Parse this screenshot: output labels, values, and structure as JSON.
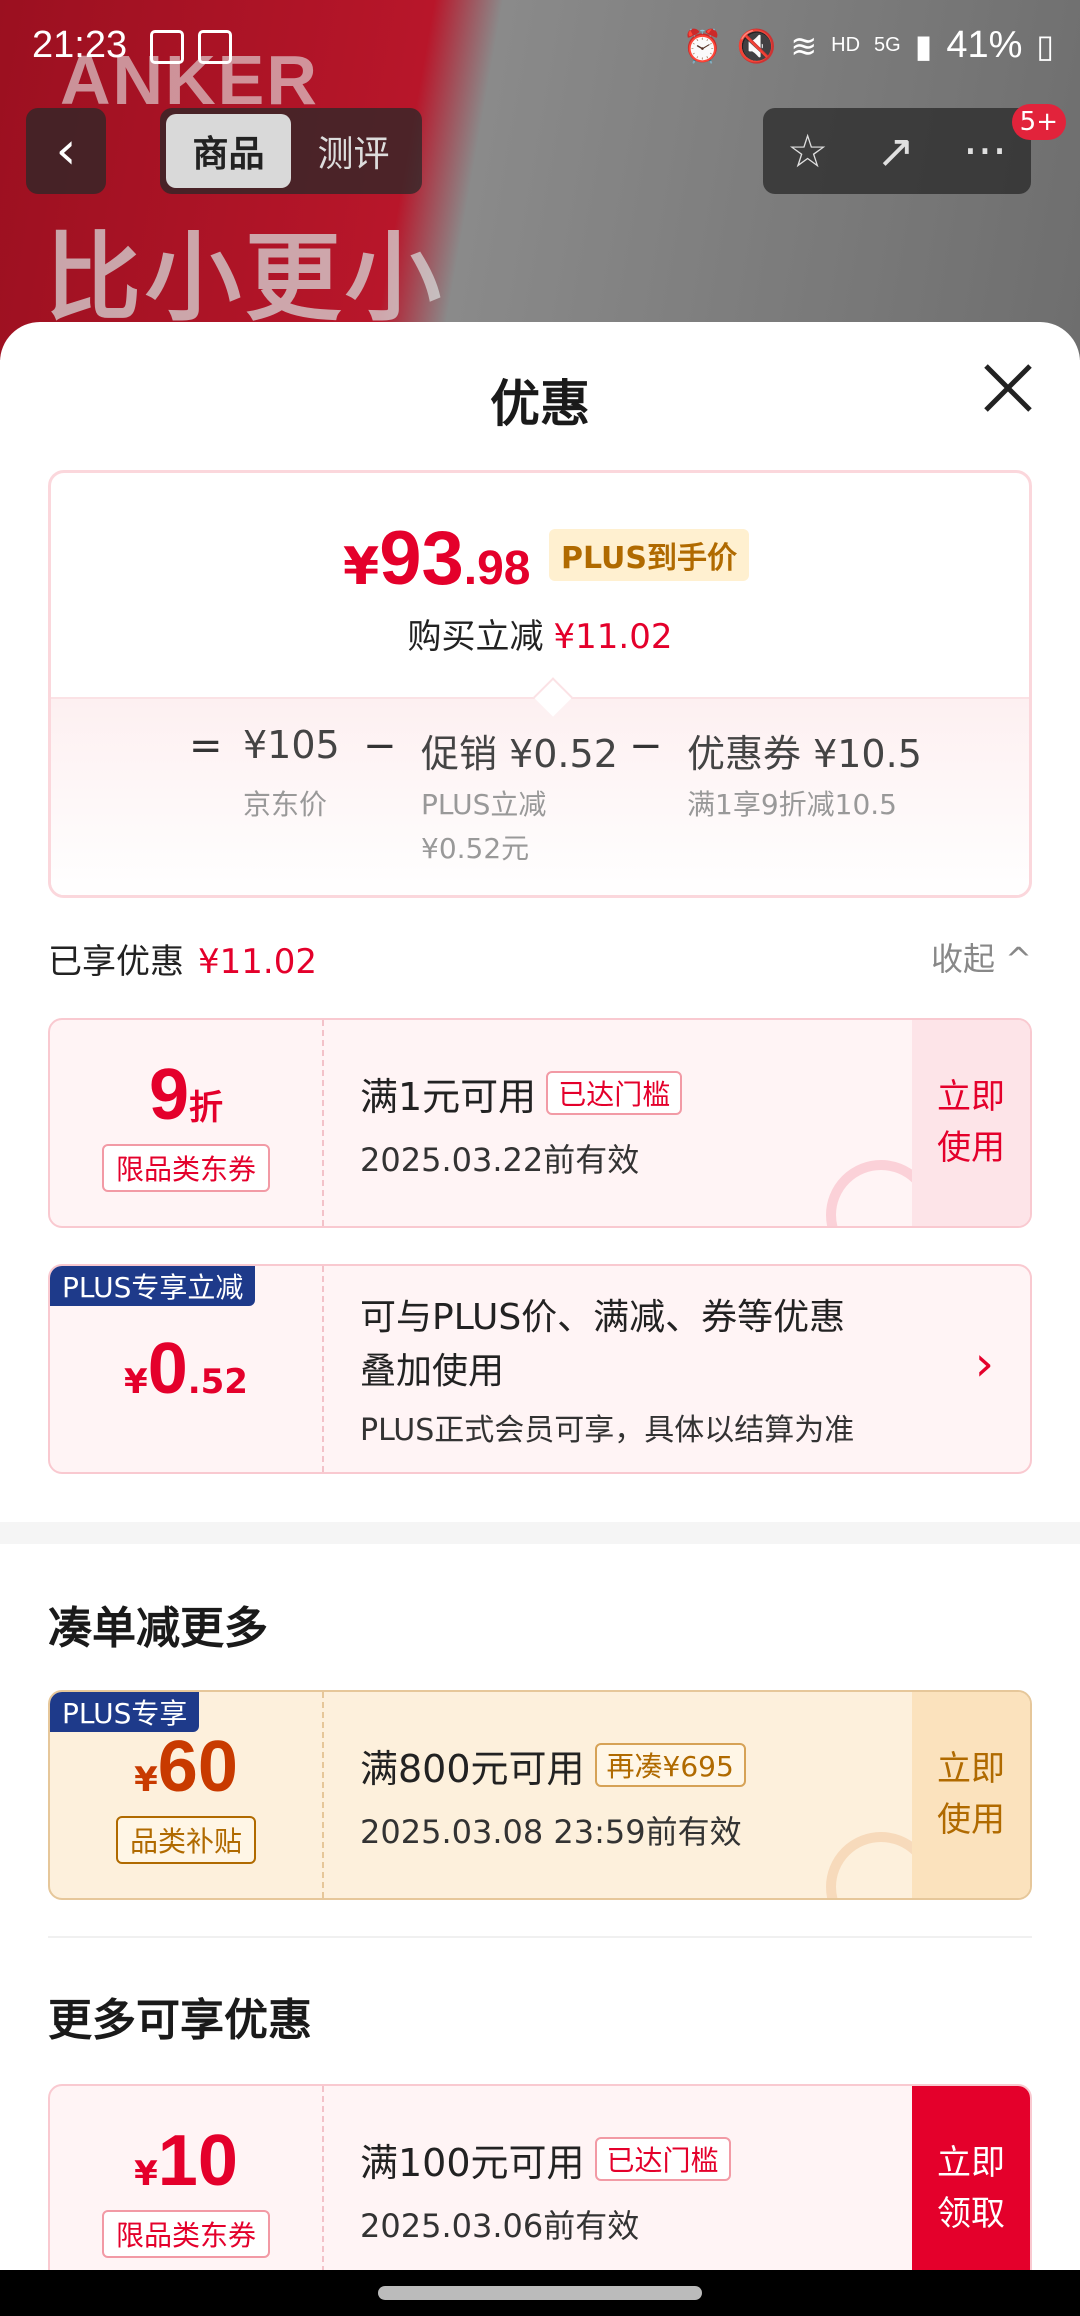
{
  "status_bar": {
    "time": "21:23",
    "network": "HD",
    "signal_label": "5G",
    "battery": "41%"
  },
  "hero": {
    "brand": "ANKER",
    "slogan": "比小更小"
  },
  "nav": {
    "back_label": "‹",
    "tabs": [
      {
        "label": "商品"
      },
      {
        "label": "测评"
      }
    ],
    "badge": "5+"
  },
  "sheet": {
    "title": "优惠",
    "price_summary": {
      "currency": "¥",
      "price_int": "93",
      "price_dec": ".98",
      "tag": "PLUS到手价",
      "save_label": "购买立减",
      "save_amount": "¥11.02",
      "jd_price": "¥105",
      "jd_price_label": "京东价",
      "promo_main": "促销 ¥0.52",
      "promo_sub1": "PLUS立减",
      "promo_sub2": "¥0.52元",
      "coupon_main": "优惠券 ¥10.5",
      "coupon_sub": "满1享9折减10.5"
    },
    "applied": {
      "label": "已享优惠",
      "amount": "¥11.02",
      "collapse": "收起 ^"
    },
    "coupon1": {
      "value": "9",
      "unit": "折",
      "type": "限品类东券",
      "condition": "满1元可用",
      "chip": "已达门槛",
      "expiry": "2025.03.22前有效",
      "action": "立即使用"
    },
    "plus_deal": {
      "tag": "PLUS专享立减",
      "currency": "¥",
      "value_int": "0",
      "value_dec": ".52",
      "line1": "可与PLUS价、满减、券等优惠",
      "line2": "叠加使用",
      "line3": "PLUS正式会员可享，具体以结算为准",
      "arrow": "›"
    },
    "section_more_title": "凑单减更多",
    "coupon2": {
      "tag": "PLUS专享",
      "currency": "¥",
      "value": "60",
      "type": "品类补贴",
      "condition": "满800元可用",
      "chip": "再凑¥695",
      "expiry": "2025.03.08 23:59前有效",
      "action": "立即使用"
    },
    "section_extra_title": "更多可享优惠",
    "coupon3": {
      "currency": "¥",
      "value": "10",
      "type": "限品类东券",
      "condition": "满100元可用",
      "chip": "已达门槛",
      "expiry": "2025.03.06前有效",
      "action": "立即领取"
    }
  },
  "colors": {
    "accent": "#e4002b",
    "plus_blue": "#1e3a8a",
    "gold": "#b06a00"
  }
}
